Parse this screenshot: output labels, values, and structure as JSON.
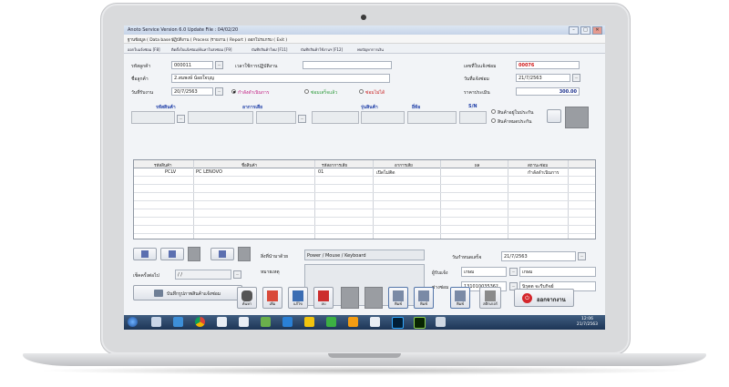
{
  "window": {
    "title": "Anoto Service Version 6.0 Update File : 04/02/20",
    "controls": [
      "–",
      "□",
      "✕"
    ]
  },
  "menu": [
    "ฐานข้อมูล ( Data base )",
    "ปฏิบัติงาน ( Process )",
    "รายงาน ( Report )",
    "ออกโปรแกรม ( Exit )"
  ],
  "shortcuts": [
    "ออกใบแจ้งซ่อม [F8]",
    "ติดตั้งใบแจ้งซ่อม/ค้นหาใบส่งซ่อม [F9]",
    "บันทึกสินค้าใหม่ [F11]",
    "บันทึกสินค้าใช้งานฯ [F12]",
    "พบปัญหาการเงิน"
  ],
  "form": {
    "customer_code_label": "รหัสลูกค้า",
    "customer_code": "000011",
    "action_time_label": "เวลาใช้การปฏิบัติงาน",
    "customer_name_label": "ชื่อลูกค้า",
    "customer_name": "2.สมพงษ์ น้อยใจบุญ",
    "receive_date_label": "วันที่รับงาน",
    "receive_date": "20/7/2563",
    "status_options": [
      "กำลังดำเนินการ",
      "ซ่อมเสร็จแล้ว",
      "ซ่อมไม่ได้"
    ],
    "repair_no_label": "เลขที่ใบแจ้งซ่อม",
    "repair_no": "00076",
    "notify_date_label": "วันที่แจ้งซ่อม",
    "notify_date": "21/7/2563",
    "price_label": "ราคาประเมิน",
    "price": "300.00"
  },
  "product_entry": {
    "headers": [
      "รหัสสินค้า",
      "อาการเสีย",
      "รุ่นสินค้า",
      "ยี่ห้อ",
      "S/N"
    ],
    "radio_options": [
      "สินค้าอยู่ในประกัน",
      "สินค้าหมดประกัน"
    ]
  },
  "table": {
    "columns": [
      "รหัสสินค้า",
      "ชื่อสินค้า",
      "รหัสอาการเสีย",
      "อาการเสีย",
      "ผล",
      "สถานะซ่อม"
    ],
    "rows": [
      {
        "code": "PCLV",
        "name": "PC LENOVO",
        "sym_code": "01",
        "symptom": "เปิดไม่ติด",
        "result": "",
        "status": "กำลังดำเนินการ"
      }
    ]
  },
  "lower": {
    "accessory_label": "สิ่งที่นำมาด้วย",
    "accessory": "Power / Mouse / Keyboard",
    "note_label": "หมายเหตุ",
    "contact_date_label": "เช็คครั้งต่อไป",
    "contact_date": "/ /",
    "photo_button": "บันทึกรูปภาพสินค้าแจ้งซ่อม",
    "finish_date_label": "วันกำหนดเสร็จ",
    "finish_date": "21/7/2563",
    "receiver_label": "ผู้รับแจ้ง",
    "receiver": "เกษม",
    "receiver2": "เกษม",
    "technician_label": "ช่างซ่อม",
    "technician_code": "13101003536?",
    "technician_name": "นิรุตต จะรีบกิจย์"
  },
  "toolbar": {
    "buttons": [
      "ค้นหา",
      "เพิ่ม",
      "แก้ไข",
      "ลบ",
      "",
      "",
      "พิมพ์",
      "พิมพ์",
      "พิมพ์",
      "สติกเกอร์"
    ],
    "close_button": "ออกจากงาน"
  },
  "taskbar": {
    "time": "12:06",
    "date": "21/7/2563"
  }
}
